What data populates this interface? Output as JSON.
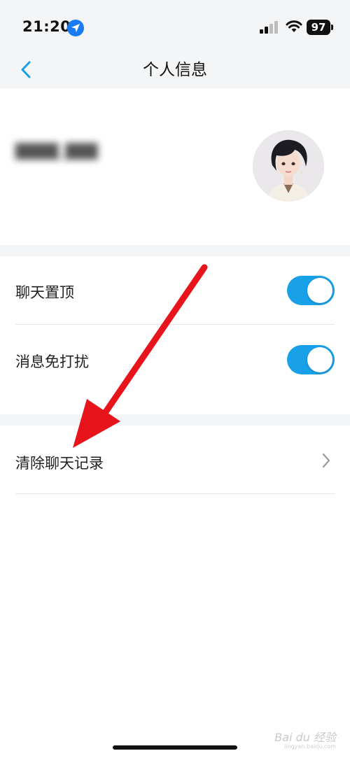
{
  "status_bar": {
    "time": "21:20",
    "battery": "97",
    "icons": [
      "location-arrow-icon",
      "cellular-signal-icon",
      "wifi-icon",
      "battery-icon"
    ]
  },
  "nav": {
    "title": "个人信息",
    "back_icon": "chevron-left-icon"
  },
  "profile": {
    "name": "████_███"
  },
  "settings": {
    "pin_chat": {
      "label": "聊天置顶",
      "on": true
    },
    "do_not_disturb": {
      "label": "消息免打扰",
      "on": true
    },
    "clear_history": {
      "label": "清除聊天记录"
    }
  },
  "watermark": {
    "text": "Bai du 经验",
    "sub": "jingyan.baidu.com"
  },
  "colors": {
    "accent": "#18a0e8",
    "annotation_arrow": "#e8141b",
    "background_band": "#f4f5f7"
  }
}
